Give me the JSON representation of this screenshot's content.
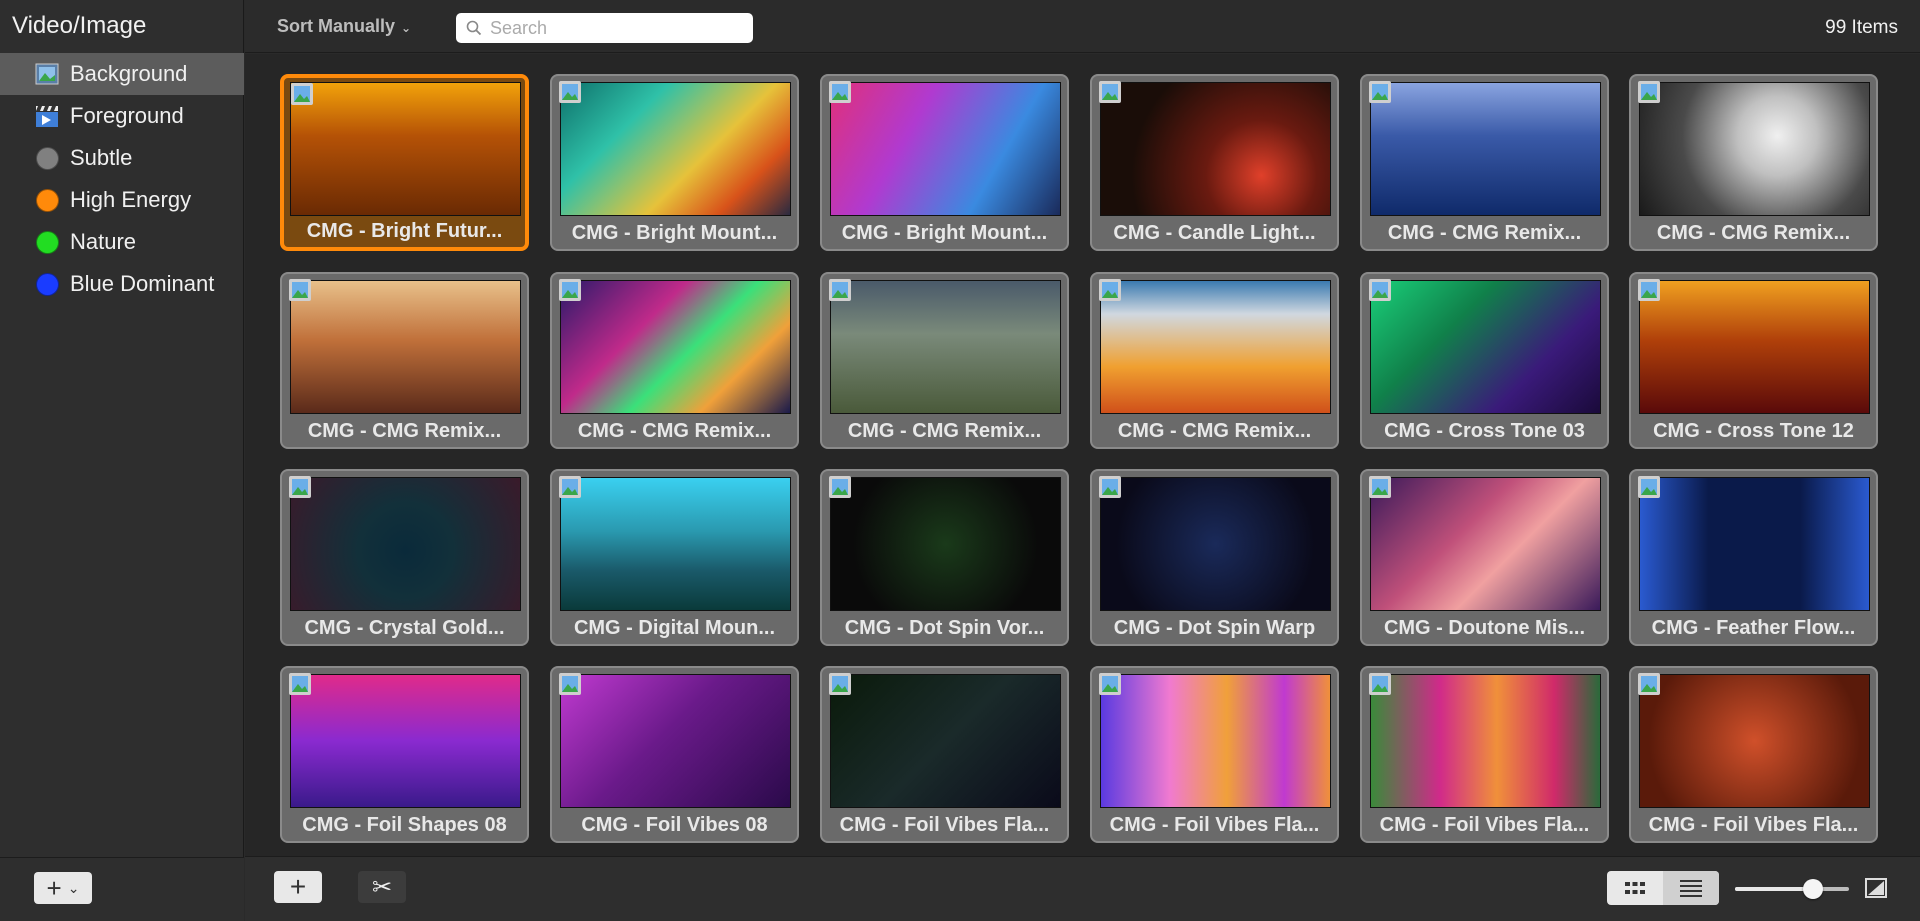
{
  "sidebar": {
    "title": "Video/Image",
    "items": [
      {
        "label": "Background",
        "icon": "image-stack-icon",
        "selected": true
      },
      {
        "label": "Foreground",
        "icon": "clapper-icon",
        "selected": false
      },
      {
        "label": "Subtle",
        "icon": "gray-dot-icon",
        "color": "#808080",
        "selected": false
      },
      {
        "label": "High Energy",
        "icon": "orange-dot-icon",
        "color": "#ff8a0a",
        "selected": false
      },
      {
        "label": "Nature",
        "icon": "green-dot-icon",
        "color": "#22dd22",
        "selected": false
      },
      {
        "label": "Blue Dominant",
        "icon": "blue-dot-icon",
        "color": "#1a3cff",
        "selected": false
      }
    ],
    "add_icon": "plus-icon",
    "add_chevron": "chevron-down-icon"
  },
  "toolbar": {
    "sort_label": "Sort Manually",
    "search_placeholder": "Search",
    "search_value": "",
    "item_count": "99 Items"
  },
  "accent_color": "#ff8a0a",
  "media": [
    {
      "label": "CMG - Bright Futur...",
      "selected": true
    },
    {
      "label": "CMG - Bright Mount..."
    },
    {
      "label": "CMG - Bright Mount..."
    },
    {
      "label": "CMG - Candle Light..."
    },
    {
      "label": "CMG - CMG Remix..."
    },
    {
      "label": "CMG - CMG Remix..."
    },
    {
      "label": "CMG - CMG Remix..."
    },
    {
      "label": "CMG - CMG Remix..."
    },
    {
      "label": "CMG - CMG Remix..."
    },
    {
      "label": "CMG - CMG Remix..."
    },
    {
      "label": "CMG - Cross Tone 03"
    },
    {
      "label": "CMG - Cross Tone 12"
    },
    {
      "label": "CMG - Crystal Gold..."
    },
    {
      "label": "CMG - Digital Moun..."
    },
    {
      "label": "CMG - Dot Spin Vor..."
    },
    {
      "label": "CMG - Dot Spin Warp"
    },
    {
      "label": "CMG - Doutone Mis..."
    },
    {
      "label": "CMG - Feather Flow..."
    },
    {
      "label": "CMG - Foil Shapes 08"
    },
    {
      "label": "CMG - Foil Vibes 08"
    },
    {
      "label": "CMG - Foil Vibes Fla..."
    },
    {
      "label": "CMG - Foil Vibes Fla..."
    },
    {
      "label": "CMG - Foil Vibes Fla..."
    },
    {
      "label": "CMG - Foil Vibes Fla..."
    }
  ],
  "bottom": {
    "add_icon": "plus-icon",
    "cut_icon": "scissors-icon",
    "grid_view_icon": "grid-view-icon",
    "list_view_icon": "list-view-icon",
    "active_view": "list",
    "zoom_level": 0.68,
    "aspect_icon": "aspect-ratio-icon"
  }
}
